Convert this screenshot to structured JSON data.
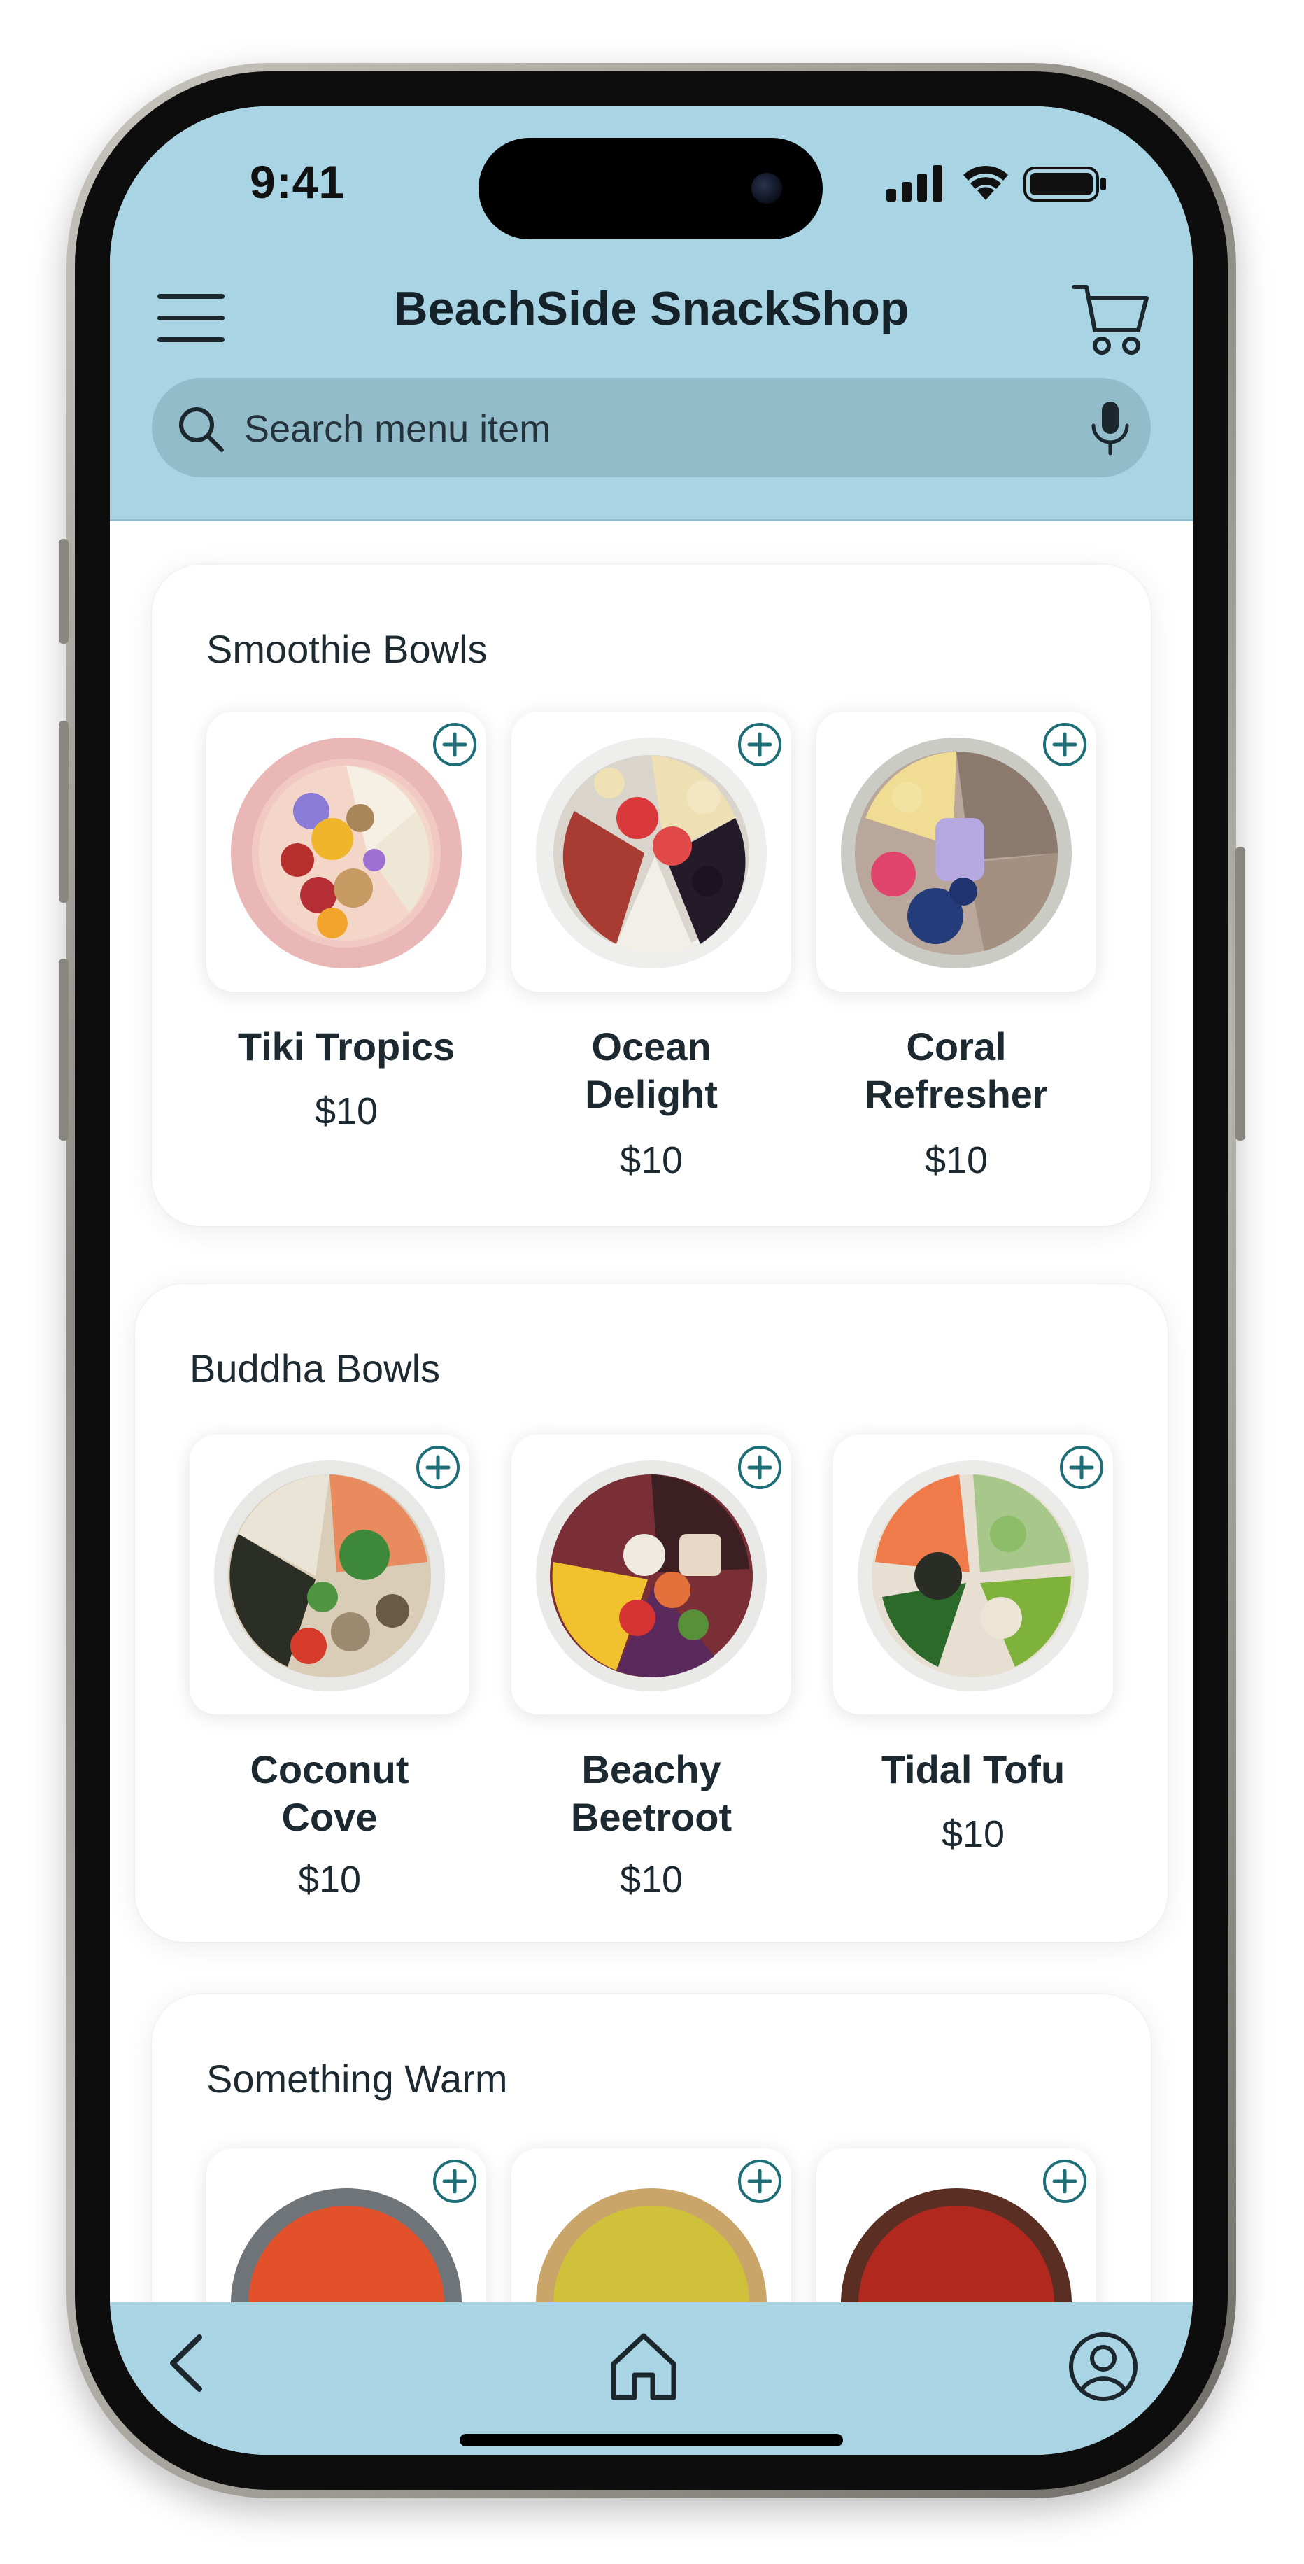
{
  "status_bar": {
    "time": "9:41"
  },
  "header": {
    "title": "BeachSide SnackShop",
    "search": {
      "placeholder": "Search menu item",
      "value": ""
    }
  },
  "categories": [
    {
      "title": "Smoothie Bowls",
      "items": [
        {
          "name": "Tiki Tropics",
          "price": "$10"
        },
        {
          "name": "Ocean Delight",
          "price": "$10"
        },
        {
          "name": "Coral Refresher",
          "price": "$10"
        }
      ]
    },
    {
      "title": "Buddha Bowls",
      "items": [
        {
          "name": "Coconut Cove",
          "price": "$10"
        },
        {
          "name": "Beachy Beetroot",
          "price": "$10"
        },
        {
          "name": "Tidal Tofu",
          "price": "$10"
        }
      ]
    },
    {
      "title": "Something Warm",
      "items": [
        {
          "name": "",
          "price": ""
        },
        {
          "name": "",
          "price": ""
        },
        {
          "name": "",
          "price": ""
        }
      ]
    }
  ],
  "icons": {
    "menu": "hamburger-menu-icon",
    "cart": "shopping-cart-icon",
    "search": "search-icon",
    "mic": "microphone-icon",
    "add": "plus-circle-icon",
    "back": "chevron-left-icon",
    "home": "home-icon",
    "profile": "user-profile-icon"
  },
  "colors": {
    "header_bg": "#a9d4e3",
    "search_bg": "#93bccb",
    "accent": "#1e6e78",
    "text": "#1c2930"
  }
}
